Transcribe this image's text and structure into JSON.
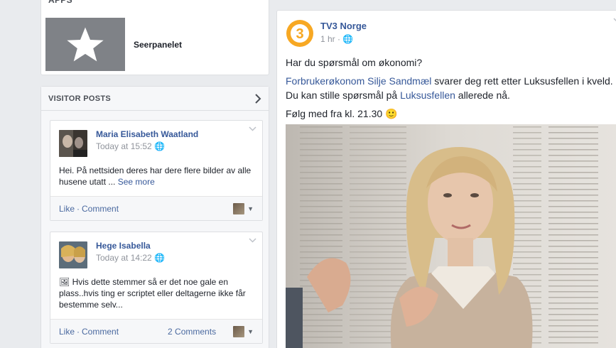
{
  "apps": {
    "header": "APPS",
    "items": [
      {
        "name": "Seerpanelet"
      }
    ]
  },
  "visitor_posts": {
    "header": "VISITOR POSTS",
    "posts": [
      {
        "author": "Maria Elisabeth Waatland",
        "time": "Today at 15:52",
        "text": "Hei. På nettsiden deres har dere flere bilder av alle husene utatt ...",
        "see_more": "See more",
        "like": "Like",
        "comment": "Comment",
        "comments_count": ""
      },
      {
        "author": "Hege Isabella",
        "time": "Today at 14:22",
        "text": "Hvis dette stemmer så er det noe gale en plass..hvis ting er scriptet eller deltagerne ikke får bestemme selv...",
        "like": "Like",
        "comment": "Comment",
        "comments_count": "2 Comments"
      }
    ]
  },
  "main_post": {
    "page_name": "TV3 Norge",
    "time": "1 hr",
    "line1": "Har du spørsmål om økonomi?",
    "line2_link": "Forbrukerøkonom Silje Sandmæl",
    "line2_text": " svarer deg rett etter Luksusfellen i kveld.",
    "line3_text": "Du kan stille spørsmål på ",
    "line3_link": "Luksusfellen",
    "line3_end": " allerede nå.",
    "line4": "Følg med fra kl. 21.30 🙂"
  },
  "colors": {
    "link": "#365899",
    "background": "#e9ebee",
    "brand_logo": "#f7a823"
  }
}
